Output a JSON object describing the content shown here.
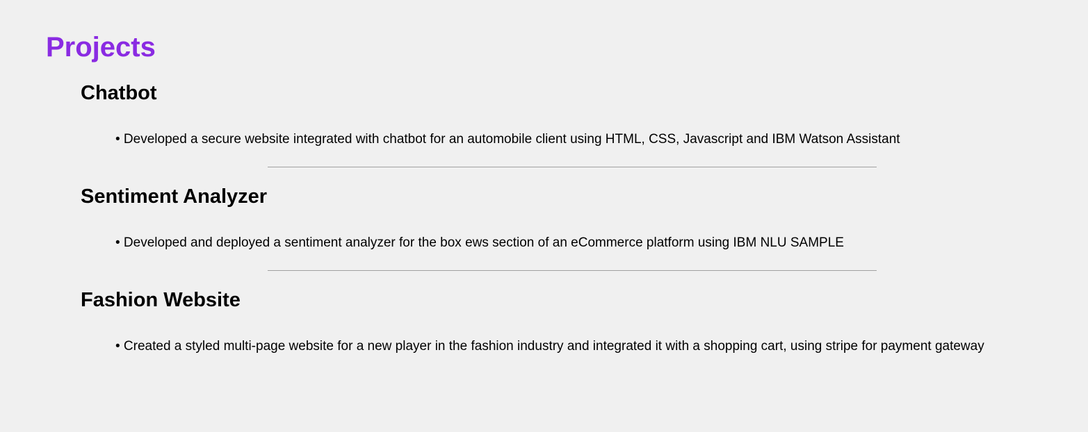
{
  "section": {
    "title": "Projects",
    "title_color": "#8a2be2"
  },
  "projects": [
    {
      "title": "Chatbot",
      "description": "• Developed a secure website integrated with chatbot for an automobile client using HTML, CSS, Javascript and IBM Watson Assistant"
    },
    {
      "title": "Sentiment Analyzer",
      "description": "• Developed and deployed a sentiment analyzer for the box ews section of an eCommerce platform using IBM NLU SAMPLE"
    },
    {
      "title": "Fashion Website",
      "description": "• Created a styled multi-page website for a new player in the fashion industry and integrated it with a shopping cart, using stripe for payment gateway"
    }
  ]
}
